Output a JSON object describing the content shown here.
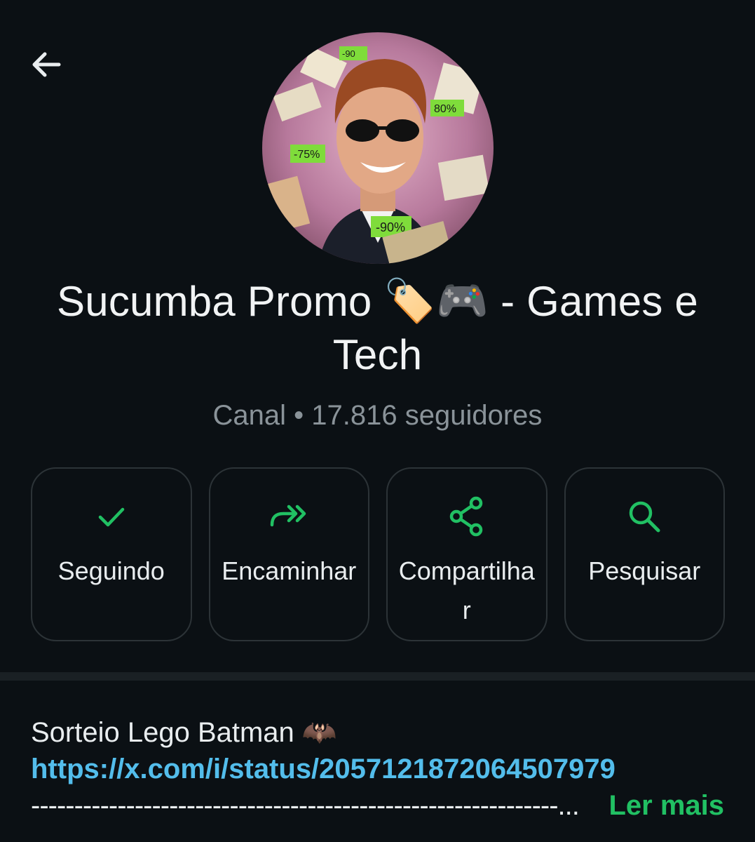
{
  "header": {
    "back_icon": "arrow-left-icon"
  },
  "channel": {
    "name_main": "Sucumba Promo",
    "name_emojis": "🏷️🎮",
    "name_rest": "- Games e Tech",
    "meta": "Canal • 17.816 seguidores",
    "avatar_tags": [
      "-90",
      "80%",
      "-75%",
      "-90%"
    ]
  },
  "actions": [
    {
      "label": "Seguindo",
      "icon": "check-icon"
    },
    {
      "label": "Encaminhar",
      "icon": "forward-icon"
    },
    {
      "label": "Compartilhar",
      "icon": "share-icon"
    },
    {
      "label": "Pesquisar",
      "icon": "search-icon"
    }
  ],
  "description": {
    "title": "Sorteio Lego Batman 🦇",
    "link": "https://x.com/i/status/2057121872064507979",
    "dashes": "-------------------------------------------------------------...",
    "read_more": "Ler mais"
  },
  "colors": {
    "background": "#0b1014",
    "accent_green": "#21c063",
    "link_blue": "#53bdeb",
    "muted_text": "#8a9399"
  }
}
